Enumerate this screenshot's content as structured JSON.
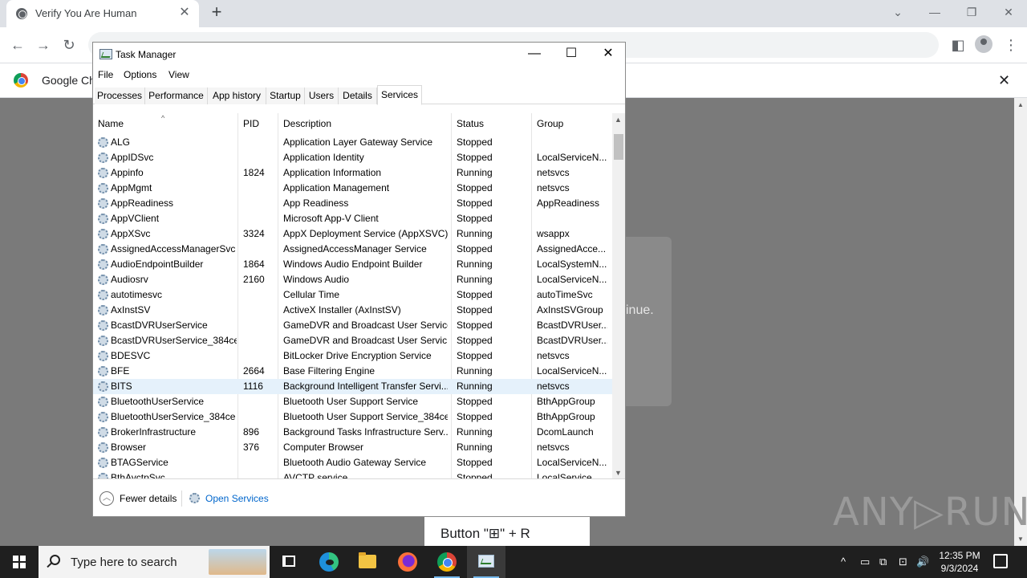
{
  "browser": {
    "tab_title": "Verify You Are Human",
    "tab_close": "✕",
    "new_tab": "+",
    "win_minimize": "⌄",
    "win_min": "—",
    "win_restore": "❐",
    "win_close": "✕",
    "back": "←",
    "forward": "→",
    "reload": "↻",
    "share": "⇪",
    "star": "☆",
    "sidepanel": "◧",
    "menu": "⋮",
    "infobar_text": "Google Ch",
    "infobar_close": "✕"
  },
  "page": {
    "dialog_partial_text": "inue.",
    "instruction_partial": "Button \"⊞\" + R",
    "watermark": "ANY▷RUN"
  },
  "task_manager": {
    "title": "Task Manager",
    "controls": {
      "minimize": "—",
      "maximize": "☐",
      "close": "✕"
    },
    "menu": [
      "File",
      "Options",
      "View"
    ],
    "tabs": [
      "Processes",
      "Performance",
      "App history",
      "Startup",
      "Users",
      "Details",
      "Services"
    ],
    "active_tab": "Services",
    "columns": [
      "Name",
      "PID",
      "Description",
      "Status",
      "Group"
    ],
    "rows": [
      {
        "name": "ALG",
        "pid": "",
        "description": "Application Layer Gateway Service",
        "status": "Stopped",
        "group": ""
      },
      {
        "name": "AppIDSvc",
        "pid": "",
        "description": "Application Identity",
        "status": "Stopped",
        "group": "LocalServiceN..."
      },
      {
        "name": "Appinfo",
        "pid": "1824",
        "description": "Application Information",
        "status": "Running",
        "group": "netsvcs"
      },
      {
        "name": "AppMgmt",
        "pid": "",
        "description": "Application Management",
        "status": "Stopped",
        "group": "netsvcs"
      },
      {
        "name": "AppReadiness",
        "pid": "",
        "description": "App Readiness",
        "status": "Stopped",
        "group": "AppReadiness"
      },
      {
        "name": "AppVClient",
        "pid": "",
        "description": "Microsoft App-V Client",
        "status": "Stopped",
        "group": ""
      },
      {
        "name": "AppXSvc",
        "pid": "3324",
        "description": "AppX Deployment Service (AppXSVC)",
        "status": "Running",
        "group": "wsappx"
      },
      {
        "name": "AssignedAccessManagerSvc",
        "pid": "",
        "description": "AssignedAccessManager Service",
        "status": "Stopped",
        "group": "AssignedAcce..."
      },
      {
        "name": "AudioEndpointBuilder",
        "pid": "1864",
        "description": "Windows Audio Endpoint Builder",
        "status": "Running",
        "group": "LocalSystemN..."
      },
      {
        "name": "Audiosrv",
        "pid": "2160",
        "description": "Windows Audio",
        "status": "Running",
        "group": "LocalServiceN..."
      },
      {
        "name": "autotimesvc",
        "pid": "",
        "description": "Cellular Time",
        "status": "Stopped",
        "group": "autoTimeSvc"
      },
      {
        "name": "AxInstSV",
        "pid": "",
        "description": "ActiveX Installer (AxInstSV)",
        "status": "Stopped",
        "group": "AxInstSVGroup"
      },
      {
        "name": "BcastDVRUserService",
        "pid": "",
        "description": "GameDVR and Broadcast User Service",
        "status": "Stopped",
        "group": "BcastDVRUser..."
      },
      {
        "name": "BcastDVRUserService_384ce",
        "pid": "",
        "description": "GameDVR and Broadcast User Servic...",
        "status": "Stopped",
        "group": "BcastDVRUser..."
      },
      {
        "name": "BDESVC",
        "pid": "",
        "description": "BitLocker Drive Encryption Service",
        "status": "Stopped",
        "group": "netsvcs"
      },
      {
        "name": "BFE",
        "pid": "2664",
        "description": "Base Filtering Engine",
        "status": "Running",
        "group": "LocalServiceN..."
      },
      {
        "name": "BITS",
        "pid": "1116",
        "description": "Background Intelligent Transfer Servi...",
        "status": "Running",
        "group": "netsvcs"
      },
      {
        "name": "BluetoothUserService",
        "pid": "",
        "description": "Bluetooth User Support Service",
        "status": "Stopped",
        "group": "BthAppGroup"
      },
      {
        "name": "BluetoothUserService_384ce",
        "pid": "",
        "description": "Bluetooth User Support Service_384ce",
        "status": "Stopped",
        "group": "BthAppGroup"
      },
      {
        "name": "BrokerInfrastructure",
        "pid": "896",
        "description": "Background Tasks Infrastructure Serv...",
        "status": "Running",
        "group": "DcomLaunch"
      },
      {
        "name": "Browser",
        "pid": "376",
        "description": "Computer Browser",
        "status": "Running",
        "group": "netsvcs"
      },
      {
        "name": "BTAGService",
        "pid": "",
        "description": "Bluetooth Audio Gateway Service",
        "status": "Stopped",
        "group": "LocalServiceN..."
      },
      {
        "name": "BthAvctpSvc",
        "pid": "",
        "description": "AVCTP service",
        "status": "Stopped",
        "group": "LocalService..."
      }
    ],
    "selected_row": "BITS",
    "footer": {
      "fewer_details": "Fewer details",
      "open_services": "Open Services"
    }
  },
  "taskbar": {
    "search_placeholder": "Type here to search",
    "time": "12:35 PM",
    "date": "9/3/2024",
    "tray": [
      "^",
      "▭",
      "⧉",
      "⊡",
      "🔊"
    ]
  }
}
